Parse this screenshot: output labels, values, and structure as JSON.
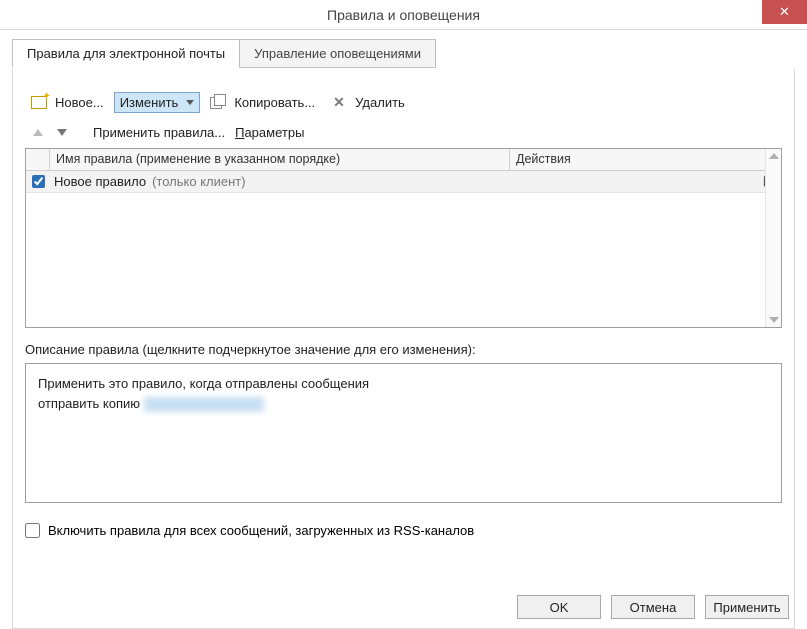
{
  "window": {
    "title": "Правила и оповещения"
  },
  "tabs": {
    "active": "Правила для электронной почты",
    "inactive": "Управление оповещениями"
  },
  "toolbar": {
    "new": "Новое...",
    "edit": "Изменить",
    "copy": "Копировать...",
    "delete": "Удалить"
  },
  "subbar": {
    "apply": "Применить правила...",
    "params": "Параметры"
  },
  "grid": {
    "header_name": "Имя правила (применение в указанном порядке)",
    "header_actions": "Действия",
    "rows": [
      {
        "checked": true,
        "name": "Новое правило",
        "hint": "(только клиент)"
      }
    ]
  },
  "description": {
    "label": "Описание правила (щелкните подчеркнутое значение для его изменения):",
    "line1": "Применить это правило, когда отправлены сообщения",
    "line2_prefix": "отправить копию "
  },
  "rss": {
    "label": "Включить правила для всех сообщений, загруженных из RSS-каналов"
  },
  "footer": {
    "ok": "OK",
    "cancel": "Отмена",
    "apply": "Применить"
  }
}
